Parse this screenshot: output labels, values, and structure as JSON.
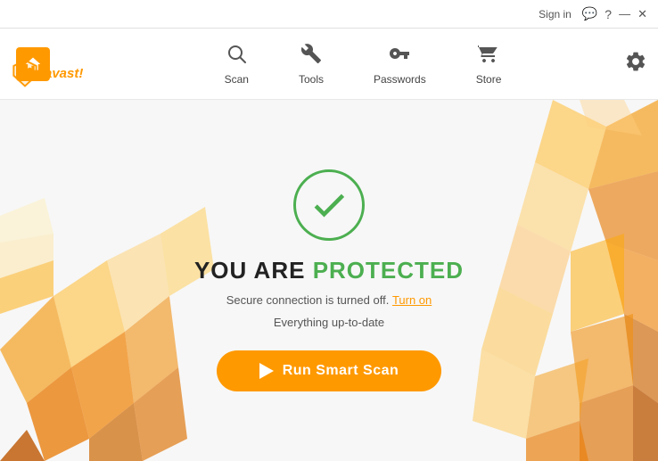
{
  "title_bar": {
    "sign_in": "Sign in",
    "chat_icon": "💬",
    "help_icon": "?",
    "minimize_icon": "—",
    "close_icon": "✕"
  },
  "logo": {
    "text": "avast!"
  },
  "nav": {
    "home_icon": "🏠",
    "items": [
      {
        "id": "scan",
        "label": "Scan",
        "icon": "🔍"
      },
      {
        "id": "tools",
        "label": "Tools",
        "icon": "🔧"
      },
      {
        "id": "passwords",
        "label": "Passwords",
        "icon": "🔑"
      },
      {
        "id": "store",
        "label": "Store",
        "icon": "🛒"
      }
    ],
    "settings_icon": "⚙"
  },
  "main": {
    "status": "YOU ARE",
    "protected": "PROTECTED",
    "check_symbol": "✓",
    "secure_connection_text": "Secure connection is turned off.",
    "turn_on_label": "Turn on",
    "uptodate_text": "Everything up-to-date",
    "scan_button_label": "Run Smart Scan",
    "accent_color": "#f90",
    "protected_color": "#4caf50"
  }
}
